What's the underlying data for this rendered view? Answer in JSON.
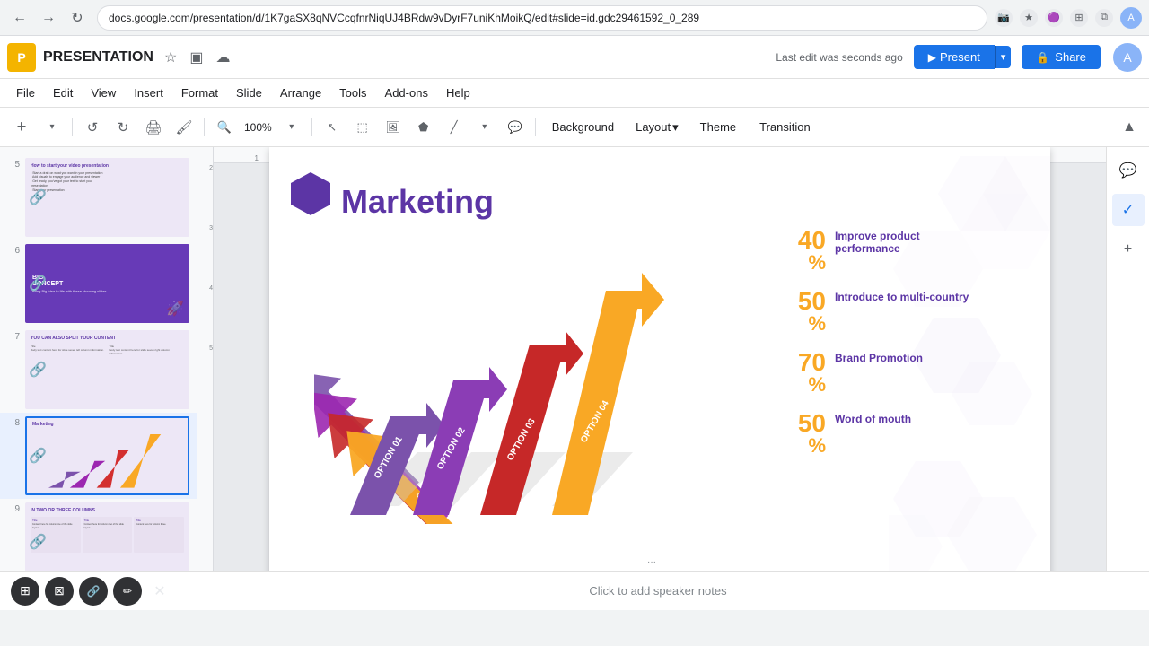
{
  "browser": {
    "back_btn": "←",
    "forward_btn": "→",
    "refresh_btn": "↻",
    "url": "docs.google.com/presentation/d/1K7gaSX8qNVCcqfnrNiqUJ4BRdw9vDyrF7uniKhMoikQ/edit#slide=id.gdc29461592_0_289",
    "extensions": [
      "📷",
      "★",
      "🟣",
      "⬛",
      "👤"
    ],
    "profile_letter": "A"
  },
  "appbar": {
    "logo_letter": "P",
    "title": "PRESENTATION",
    "save_status": "Last edit was seconds ago",
    "present_label": "Present",
    "share_label": "Share"
  },
  "menubar": {
    "items": [
      "File",
      "Edit",
      "View",
      "Insert",
      "Format",
      "Slide",
      "Arrange",
      "Tools",
      "Add-ons",
      "Help"
    ]
  },
  "toolbar": {
    "zoom_in": "+",
    "zoom_out": "−",
    "undo": "↺",
    "redo": "↻",
    "print": "🖨",
    "paint_format": "🖌",
    "zoom_level": "100%",
    "background_label": "Background",
    "layout_label": "Layout",
    "layout_arrow": "▾",
    "theme_label": "Theme",
    "transition_label": "Transition"
  },
  "slides": [
    {
      "num": "5",
      "title": "How to start your video presentation",
      "active": false
    },
    {
      "num": "6",
      "title": "BIG CONCEPT",
      "active": false
    },
    {
      "num": "7",
      "title": "YOU CAN ALSO SPLIT YOUR CONTENT",
      "active": false
    },
    {
      "num": "8",
      "title": "Marketing",
      "active": true
    },
    {
      "num": "9",
      "title": "IN TWO OR THREE COLUMNS",
      "active": false
    }
  ],
  "slide": {
    "title": "Marketing",
    "hex_color": "#5c35a5",
    "stats": [
      {
        "value": "40%",
        "label": "Improve product performance",
        "color": "#f9a825"
      },
      {
        "value": "50%",
        "label": "Introduce to multi-country",
        "color": "#f9a825"
      },
      {
        "value": "70%",
        "label": "Brand Promotion",
        "color": "#f9a825"
      },
      {
        "value": "50%",
        "label": "Word of mouth",
        "color": "#f9a825"
      }
    ],
    "options": [
      {
        "label": "OPTION 01",
        "color": "#7b52ab"
      },
      {
        "label": "OPTION 02",
        "color": "#9c27b0"
      },
      {
        "label": "OPTION 03",
        "color": "#d32f2f"
      },
      {
        "label": "OPTION 04",
        "color": "#f9a825"
      }
    ]
  },
  "speaker_notes_placeholder": "Click to add speaker notes",
  "bottom_bar": {
    "grid_icon": "⊞",
    "expand_icon": "⊠",
    "link_icon": "🔗",
    "pen_icon": "✏",
    "close_icon": "✕"
  },
  "right_sidebar": {
    "chat_icon": "💬",
    "check_icon": "✓",
    "add_icon": "+"
  }
}
